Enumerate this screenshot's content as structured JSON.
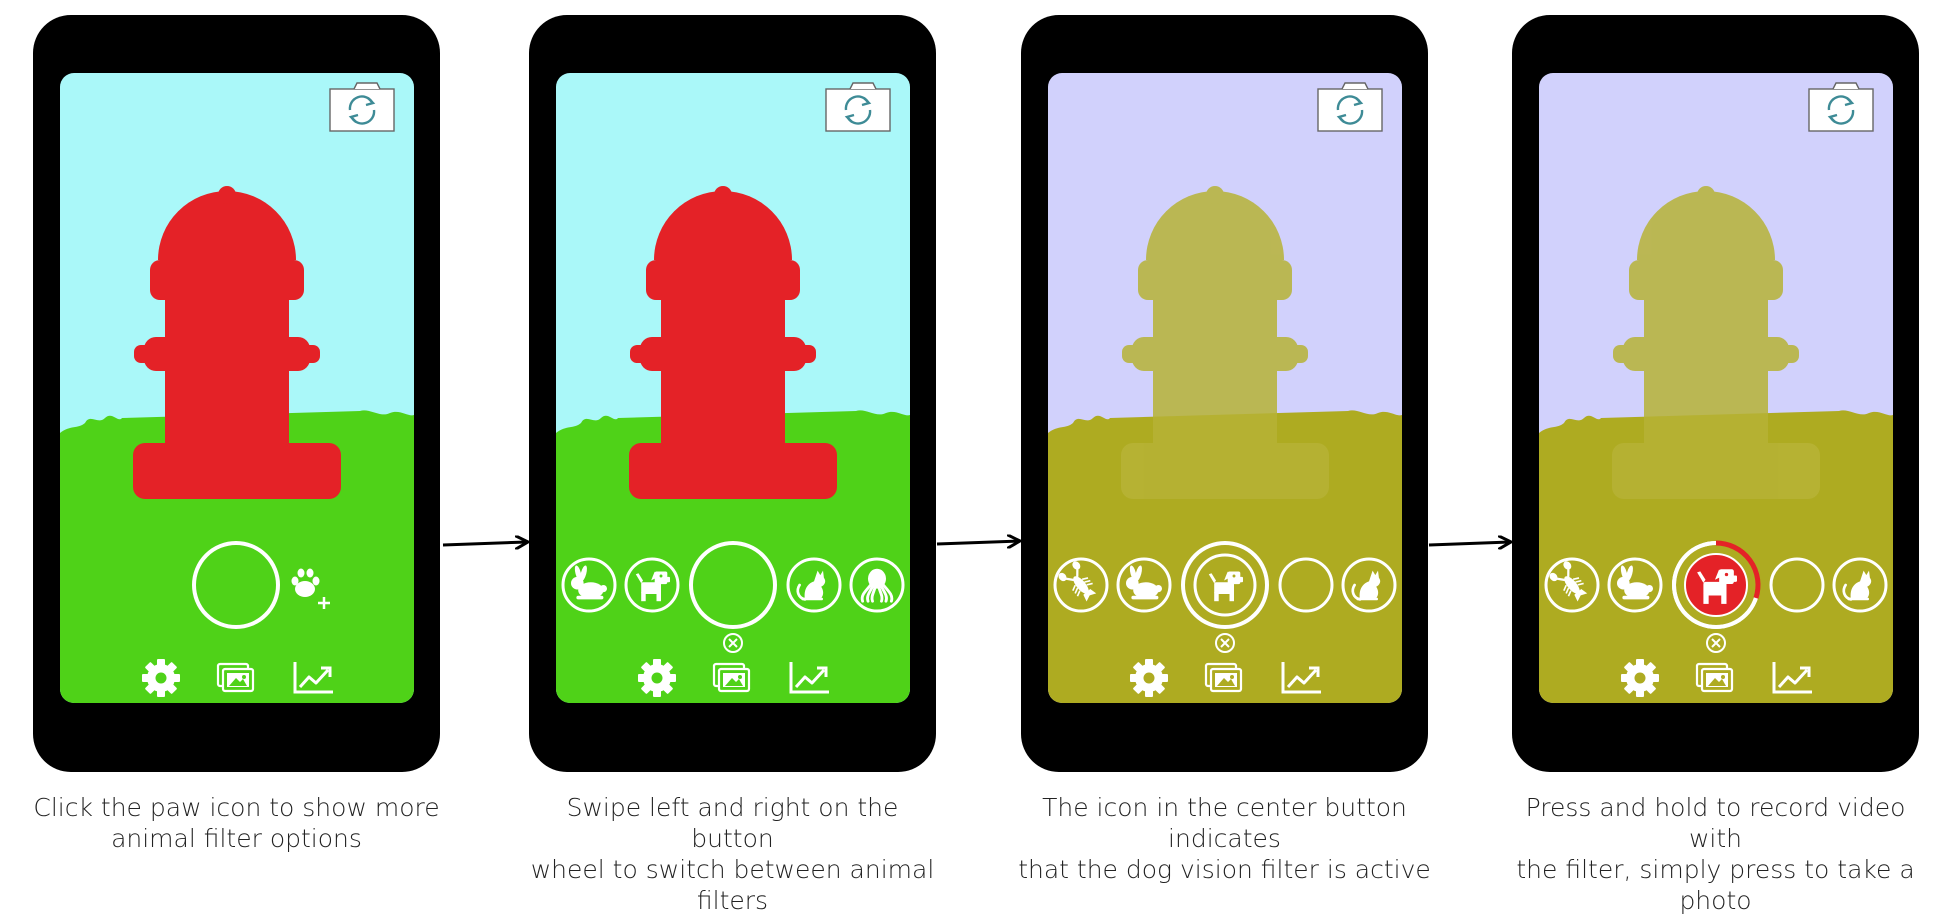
{
  "panels": [
    {
      "id": "step1",
      "sky_color": "#aaf8f9",
      "grass_color": "#4fd218",
      "hydrant_color": "#e42227",
      "filter_active": false,
      "wheel": {
        "left": [],
        "center": "empty",
        "right": [
          "paw-plus"
        ]
      },
      "show_close_badge": false,
      "recording_progress": 0,
      "caption": [
        "Click the paw icon to show more",
        "animal filter options"
      ]
    },
    {
      "id": "step2",
      "sky_color": "#aaf8f9",
      "grass_color": "#4fd218",
      "hydrant_color": "#e42227",
      "filter_active": false,
      "wheel": {
        "left": [
          "rabbit",
          "dog"
        ],
        "center": "empty",
        "right": [
          "cat",
          "octopus"
        ]
      },
      "show_close_badge": true,
      "recording_progress": 0,
      "caption": [
        "Swipe left and right on the button",
        "wheel to switch between animal filters"
      ]
    },
    {
      "id": "step3",
      "sky_color": "#d1d1fc",
      "grass_color": "#aeab21",
      "hydrant_color": "#b7b336",
      "filter_active": true,
      "wheel": {
        "left": [
          "lobster",
          "rabbit"
        ],
        "center": "dog",
        "right": [
          "empty",
          "cat"
        ]
      },
      "show_close_badge": true,
      "recording_progress": 0,
      "caption": [
        "The icon in the center button indicates",
        "that the dog vision filter is active"
      ]
    },
    {
      "id": "step4",
      "sky_color": "#d1d1fc",
      "grass_color": "#aeab21",
      "hydrant_color": "#b7b336",
      "filter_active": true,
      "wheel": {
        "left": [
          "lobster",
          "rabbit"
        ],
        "center": "dog-recording",
        "right": [
          "empty",
          "cat"
        ]
      },
      "show_close_badge": true,
      "recording_progress": 0.3,
      "caption": [
        "Press and hold to record video with",
        "the filter, simply press to take a photo"
      ]
    }
  ],
  "bottom_bar_icons": [
    "gear-icon",
    "gallery-icon",
    "chart-icon"
  ],
  "top_icon": "camera-switch-icon",
  "colors": {
    "phone_body": "#000000",
    "icon": "#ffffff",
    "record_red": "#e42227",
    "arrow": "#000000"
  }
}
